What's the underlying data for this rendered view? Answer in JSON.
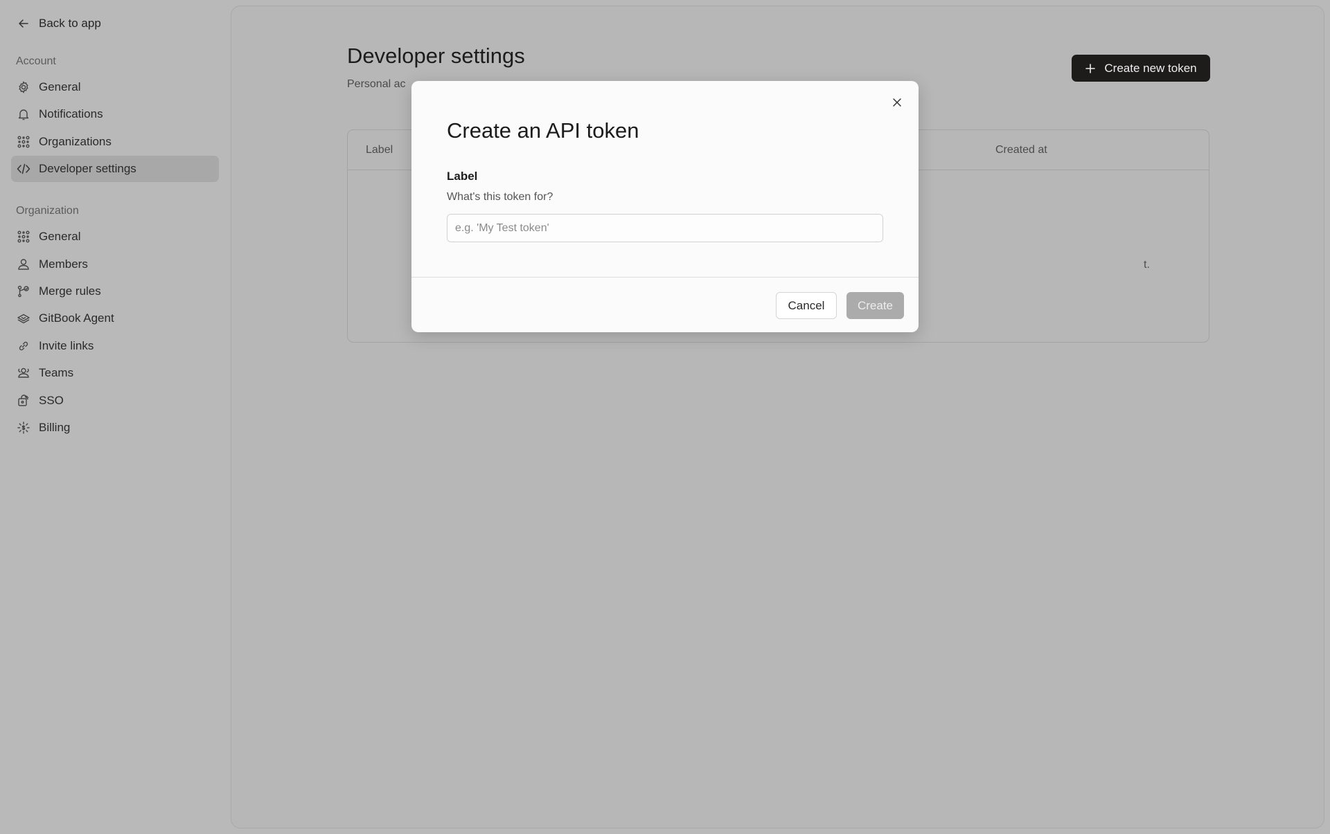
{
  "sidebar": {
    "back_label": "Back to app",
    "account_heading": "Account",
    "account_items": [
      {
        "label": "General",
        "icon": "gear-icon"
      },
      {
        "label": "Notifications",
        "icon": "bell-icon"
      },
      {
        "label": "Organizations",
        "icon": "organizations-icon"
      },
      {
        "label": "Developer settings",
        "icon": "code-icon",
        "active": true
      }
    ],
    "organization_heading": "Organization",
    "organization_items": [
      {
        "label": "General",
        "icon": "organizations-icon"
      },
      {
        "label": "Members",
        "icon": "member-icon"
      },
      {
        "label": "Merge rules",
        "icon": "merge-icon"
      },
      {
        "label": "GitBook Agent",
        "icon": "agent-icon"
      },
      {
        "label": "Invite links",
        "icon": "link-icon"
      },
      {
        "label": "Teams",
        "icon": "teams-icon"
      },
      {
        "label": "SSO",
        "icon": "sso-icon"
      },
      {
        "label": "Billing",
        "icon": "billing-icon"
      }
    ]
  },
  "main": {
    "title": "Developer settings",
    "subtitle": "Personal ac",
    "create_button_label": "Create new token",
    "table": {
      "col_label": "Label",
      "col_created": "Created at",
      "empty_tail": "t."
    }
  },
  "modal": {
    "title": "Create an API token",
    "field_label": "Label",
    "field_help": "What's this token for?",
    "field_placeholder": "e.g. 'My Test token'",
    "field_value": "",
    "cancel_label": "Cancel",
    "create_label": "Create"
  },
  "colors": {
    "overlay_background": "#b9b9b9",
    "primary_button": "#1e1b1b",
    "disabled_button": "#ababab",
    "modal_background": "#fbfbfb"
  }
}
